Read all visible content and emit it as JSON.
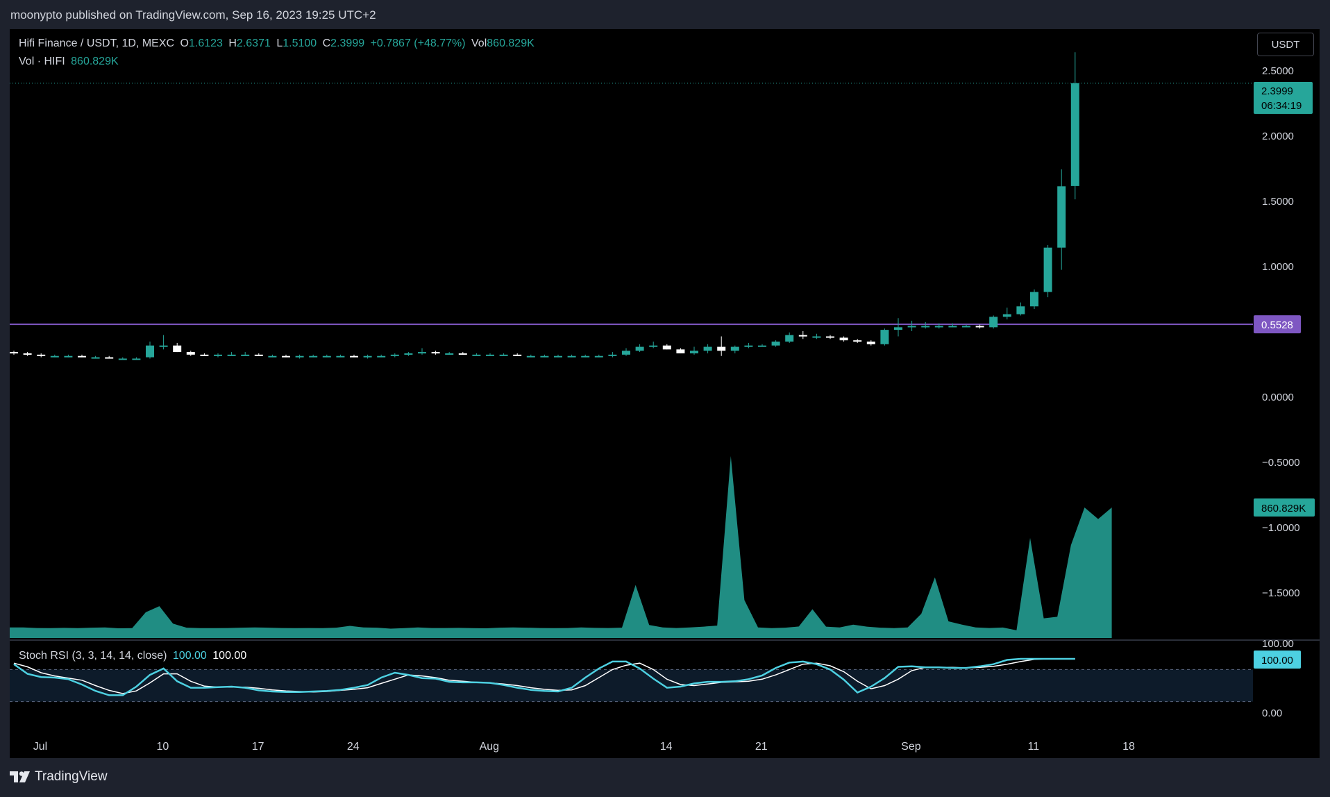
{
  "header": {
    "published_by": "moonypto published on TradingView.com, Sep 16, 2023 19:25 UTC+2"
  },
  "legend": {
    "symbol": "Hifi Finance / USDT, 1D, MEXC",
    "open_label": "O",
    "open": "1.6123",
    "high_label": "H",
    "high": "2.6371",
    "low_label": "L",
    "low": "1.5100",
    "close_label": "C",
    "close": "2.3999",
    "change": "+0.7867 (+48.77%)",
    "vol_label": "Vol",
    "vol": "860.829K",
    "vol_series_label": "Vol · HIFI",
    "vol_series_value": "860.829K"
  },
  "currency_button": "USDT",
  "price_tag": {
    "price": "2.3999",
    "countdown": "06:34:19"
  },
  "horizontal_line": {
    "value": 0.5528,
    "label": "0.5528",
    "color": "#7e57c2"
  },
  "volume_tag": "860.829K",
  "stoch": {
    "title": "Stoch RSI (3, 3, 14, 14, close)",
    "k_value": "100.00",
    "d_value": "100.00",
    "axis_top_label": "100.00",
    "axis_tag": "100.00",
    "axis_bottom_label": "0.00",
    "k_color": "#4dd0e1",
    "d_color": "#ffffff",
    "k": [
      90,
      72,
      66,
      65,
      62,
      52,
      40,
      32,
      32,
      48,
      70,
      82,
      58,
      46,
      46,
      47,
      48,
      46,
      41,
      39,
      38,
      38,
      39,
      40,
      42,
      46,
      51,
      65,
      74,
      70,
      64,
      63,
      57,
      56,
      56,
      55,
      51,
      46,
      42,
      40,
      39,
      46,
      65,
      82,
      95,
      95,
      82,
      63,
      46,
      48,
      54,
      57,
      57,
      58,
      62,
      69,
      83,
      93,
      95,
      90,
      80,
      61,
      37,
      48,
      64,
      85,
      86,
      84,
      84,
      83,
      83,
      86,
      90,
      98,
      100,
      100,
      100,
      100,
      100
    ],
    "d": [
      92,
      85,
      74,
      68,
      64,
      60,
      50,
      41,
      35,
      40,
      55,
      72,
      72,
      58,
      49,
      47,
      47,
      47,
      45,
      42,
      40,
      39,
      38,
      39,
      41,
      43,
      46,
      54,
      62,
      70,
      68,
      65,
      60,
      58,
      56,
      55,
      53,
      50,
      46,
      43,
      41,
      42,
      50,
      65,
      80,
      88,
      92,
      80,
      62,
      52,
      50,
      53,
      56,
      57,
      58,
      62,
      70,
      80,
      90,
      92,
      87,
      76,
      58,
      44,
      50,
      62,
      78,
      84,
      84,
      84,
      83,
      84,
      86,
      90,
      95,
      99,
      100,
      100,
      100
    ]
  },
  "watermark": "TradingView",
  "chart_data": {
    "type": "candlestick",
    "symbol": "HIFI/USDT",
    "interval": "1D",
    "exchange": "MEXC",
    "x_tick_labels": [
      "Jul",
      "10",
      "17",
      "24",
      "Aug",
      "14",
      "21",
      "Sep",
      "11",
      "18"
    ],
    "x_tick_index": [
      0,
      9,
      16,
      23,
      33,
      46,
      53,
      64,
      73,
      80
    ],
    "y_tick_labels": [
      "2.5000",
      "2.0000",
      "1.5000",
      "1.0000",
      "0.0000",
      "−0.5000",
      "−1.0000",
      "−1.5000"
    ],
    "y_tick_values": [
      2.5,
      2.0,
      1.5,
      1.0,
      0.0,
      -0.5,
      -1.0,
      -1.5
    ],
    "ylim": [
      -1.8,
      2.8
    ],
    "candles_ohlc": [
      [
        0.34,
        0.35,
        0.32,
        0.33
      ],
      [
        0.33,
        0.34,
        0.31,
        0.32
      ],
      [
        0.32,
        0.33,
        0.3,
        0.31
      ],
      [
        0.31,
        0.32,
        0.3,
        0.31
      ],
      [
        0.31,
        0.32,
        0.3,
        0.31
      ],
      [
        0.31,
        0.32,
        0.3,
        0.3
      ],
      [
        0.3,
        0.31,
        0.29,
        0.3
      ],
      [
        0.3,
        0.31,
        0.29,
        0.29
      ],
      [
        0.29,
        0.3,
        0.28,
        0.29
      ],
      [
        0.29,
        0.3,
        0.28,
        0.29
      ],
      [
        0.3,
        0.42,
        0.29,
        0.39
      ],
      [
        0.39,
        0.47,
        0.36,
        0.39
      ],
      [
        0.39,
        0.41,
        0.34,
        0.34
      ],
      [
        0.34,
        0.35,
        0.31,
        0.32
      ],
      [
        0.32,
        0.33,
        0.31,
        0.31
      ],
      [
        0.31,
        0.33,
        0.3,
        0.32
      ],
      [
        0.32,
        0.34,
        0.31,
        0.32
      ],
      [
        0.32,
        0.34,
        0.31,
        0.32
      ],
      [
        0.32,
        0.33,
        0.31,
        0.31
      ],
      [
        0.31,
        0.32,
        0.3,
        0.31
      ],
      [
        0.31,
        0.32,
        0.3,
        0.3
      ],
      [
        0.3,
        0.32,
        0.29,
        0.31
      ],
      [
        0.31,
        0.32,
        0.3,
        0.31
      ],
      [
        0.31,
        0.32,
        0.3,
        0.31
      ],
      [
        0.31,
        0.32,
        0.3,
        0.31
      ],
      [
        0.31,
        0.32,
        0.3,
        0.3
      ],
      [
        0.3,
        0.32,
        0.29,
        0.31
      ],
      [
        0.31,
        0.32,
        0.3,
        0.31
      ],
      [
        0.31,
        0.33,
        0.3,
        0.32
      ],
      [
        0.32,
        0.34,
        0.31,
        0.33
      ],
      [
        0.33,
        0.37,
        0.32,
        0.34
      ],
      [
        0.34,
        0.35,
        0.32,
        0.33
      ],
      [
        0.33,
        0.34,
        0.32,
        0.33
      ],
      [
        0.33,
        0.34,
        0.32,
        0.32
      ],
      [
        0.32,
        0.33,
        0.31,
        0.32
      ],
      [
        0.32,
        0.33,
        0.31,
        0.32
      ],
      [
        0.32,
        0.33,
        0.31,
        0.32
      ],
      [
        0.32,
        0.33,
        0.31,
        0.31
      ],
      [
        0.31,
        0.32,
        0.3,
        0.31
      ],
      [
        0.31,
        0.32,
        0.3,
        0.31
      ],
      [
        0.31,
        0.32,
        0.3,
        0.31
      ],
      [
        0.31,
        0.32,
        0.3,
        0.31
      ],
      [
        0.31,
        0.32,
        0.3,
        0.31
      ],
      [
        0.31,
        0.32,
        0.3,
        0.31
      ],
      [
        0.31,
        0.34,
        0.3,
        0.32
      ],
      [
        0.32,
        0.37,
        0.31,
        0.35
      ],
      [
        0.35,
        0.4,
        0.34,
        0.38
      ],
      [
        0.38,
        0.42,
        0.37,
        0.39
      ],
      [
        0.39,
        0.4,
        0.36,
        0.36
      ],
      [
        0.36,
        0.37,
        0.33,
        0.33
      ],
      [
        0.33,
        0.38,
        0.32,
        0.35
      ],
      [
        0.35,
        0.4,
        0.33,
        0.38
      ],
      [
        0.38,
        0.46,
        0.31,
        0.35
      ],
      [
        0.35,
        0.39,
        0.33,
        0.38
      ],
      [
        0.38,
        0.41,
        0.37,
        0.39
      ],
      [
        0.39,
        0.4,
        0.38,
        0.39
      ],
      [
        0.39,
        0.43,
        0.38,
        0.42
      ],
      [
        0.42,
        0.49,
        0.41,
        0.47
      ],
      [
        0.47,
        0.5,
        0.44,
        0.46
      ],
      [
        0.46,
        0.48,
        0.44,
        0.46
      ],
      [
        0.46,
        0.47,
        0.44,
        0.45
      ],
      [
        0.45,
        0.46,
        0.42,
        0.43
      ],
      [
        0.43,
        0.44,
        0.41,
        0.42
      ],
      [
        0.42,
        0.43,
        0.39,
        0.4
      ],
      [
        0.4,
        0.52,
        0.39,
        0.51
      ],
      [
        0.51,
        0.6,
        0.46,
        0.53
      ],
      [
        0.53,
        0.58,
        0.5,
        0.54
      ],
      [
        0.54,
        0.57,
        0.52,
        0.54
      ],
      [
        0.54,
        0.56,
        0.52,
        0.54
      ],
      [
        0.54,
        0.56,
        0.53,
        0.54
      ],
      [
        0.54,
        0.55,
        0.53,
        0.54
      ],
      [
        0.54,
        0.55,
        0.52,
        0.53
      ],
      [
        0.53,
        0.62,
        0.52,
        0.61
      ],
      [
        0.61,
        0.68,
        0.59,
        0.63
      ],
      [
        0.63,
        0.72,
        0.62,
        0.69
      ],
      [
        0.69,
        0.82,
        0.67,
        0.8
      ],
      [
        0.8,
        1.16,
        0.76,
        1.14
      ],
      [
        1.14,
        1.74,
        0.97,
        1.61
      ],
      [
        1.6123,
        2.6371,
        1.51,
        2.3999
      ]
    ],
    "volume": [
      70,
      70,
      66,
      65,
      67,
      65,
      68,
      70,
      64,
      65,
      170,
      210,
      95,
      68,
      65,
      65,
      66,
      68,
      70,
      68,
      66,
      65,
      66,
      65,
      68,
      80,
      70,
      68,
      62,
      65,
      70,
      66,
      66,
      67,
      65,
      64,
      68,
      70,
      68,
      66,
      65,
      66,
      70,
      67,
      66,
      68,
      350,
      86,
      70,
      66,
      70,
      75,
      82,
      1200,
      250,
      70,
      65,
      68,
      76,
      190,
      75,
      70,
      88,
      75,
      68,
      65,
      70,
      160,
      400,
      110,
      88,
      70,
      66,
      69,
      51,
      660,
      130,
      140,
      612,
      860.829,
      785,
      860.829
    ],
    "volume_label": "Vol · HIFI",
    "last_volume": 860.829,
    "horizontal_line": 0.5528
  }
}
